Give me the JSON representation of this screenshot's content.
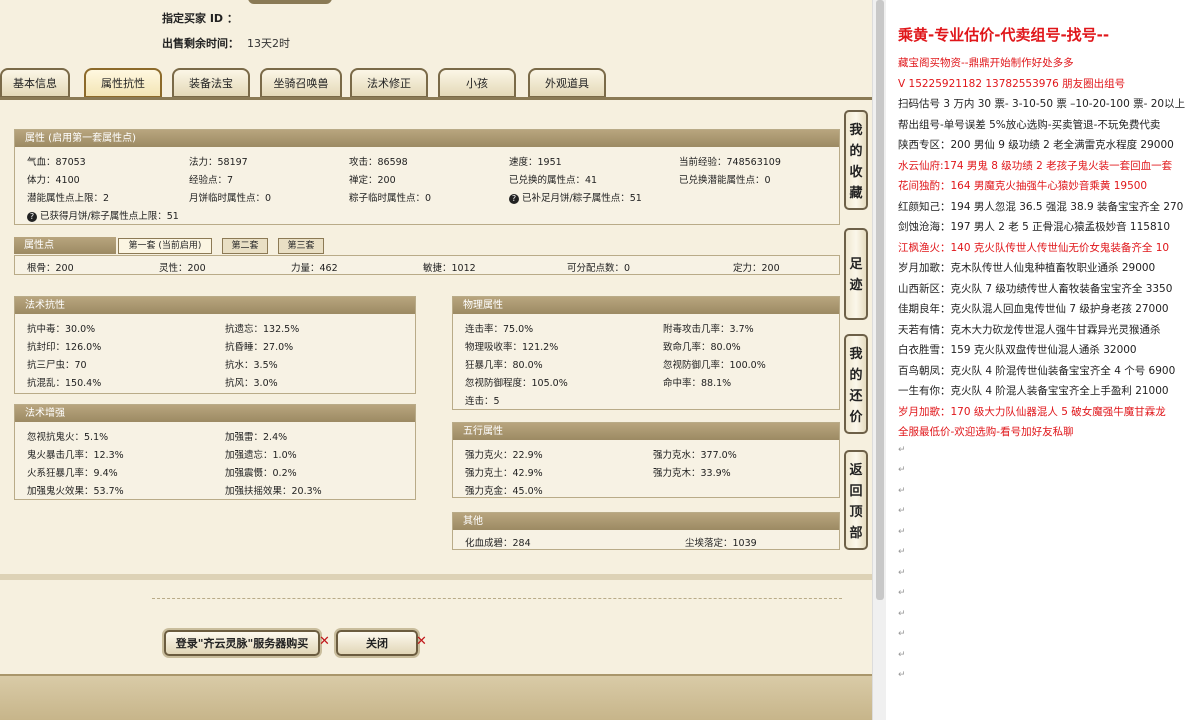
{
  "header": {
    "buyer_id_label": "指定买家 ID ：",
    "time_left_label": "出售剩余时间：",
    "time_left_value": "13天2时"
  },
  "tabs": [
    "基本信息",
    "属性抗性",
    "装备法宝",
    "坐骑召唤兽",
    "法术修正",
    "小孩",
    "外观道具"
  ],
  "attr_panel": {
    "title": "属性 (启用第一套属性点)",
    "rows": [
      [
        "气血：87053",
        "法力：58197",
        "攻击：86598",
        "速度：1951",
        "当前经验：748563109"
      ],
      [
        "体力：4100",
        "经验点：7",
        "禅定：200",
        "已兑换的属性点：41",
        "已兑换潜能属性点：0"
      ],
      [
        "潜能属性点上限：2",
        "月饼临时属性点：0",
        "粽子临时属性点：0",
        "已补足月饼/粽子属性点：51"
      ],
      [
        "已获得月饼/粽子属性点上限：51"
      ]
    ]
  },
  "points_panel": {
    "title": "属性点",
    "subtabs": [
      "第一套 (当前启用)",
      "第二套",
      "第三套"
    ],
    "values": [
      "根骨：200",
      "灵性：200",
      "力量：462",
      "敏捷：1012",
      "可分配点数：0",
      "定力：200"
    ]
  },
  "resist_panel": {
    "title": "法术抗性",
    "items": [
      "抗中毒：30.0%",
      "抗遗忘：132.5%",
      "抗封印：126.0%",
      "抗昏睡：27.0%",
      "抗三尸虫：70",
      "抗水：3.5%",
      "抗混乱：150.4%",
      "抗风：3.0%"
    ]
  },
  "enhance_panel": {
    "title": "法术增强",
    "items": [
      "忽视抗鬼火：5.1%",
      "加强雷：2.4%",
      "鬼火暴击几率：12.3%",
      "加强遗忘：1.0%",
      "火系狂暴几率：9.4%",
      "加强震慑：0.2%",
      "加强鬼火效果：53.7%",
      "加强扶摇效果：20.3%"
    ]
  },
  "physical_panel": {
    "title": "物理属性",
    "items": [
      "连击率：75.0%",
      "附毒攻击几率：3.7%",
      "物理吸收率：121.2%",
      "致命几率：80.0%",
      "狂暴几率：80.0%",
      "忽视防御几率：100.0%",
      "忽视防御程度：105.0%",
      "命中率：88.1%",
      "连击：5"
    ]
  },
  "element_panel": {
    "title": "五行属性",
    "items": [
      "强力克火：22.9%",
      "强力克水：377.0%",
      "强力克土：42.9%",
      "强力克木：33.9%",
      "强力克金：45.0%"
    ]
  },
  "other_panel": {
    "title": "其他",
    "items": [
      "化血成碧：284",
      "尘埃落定：1039"
    ]
  },
  "side_buttons": [
    [
      "我",
      "的",
      "收",
      "藏"
    ],
    [
      "足",
      "迹"
    ],
    [
      "我",
      "的",
      "还",
      "价"
    ],
    [
      "返",
      "回",
      "顶",
      "部"
    ]
  ],
  "bottom": {
    "login_button": "登录\"齐云灵脉\"服务器购买",
    "close_button": "关闭",
    "x": "✕"
  },
  "doc": {
    "lines": [
      {
        "t": "乘黄-专业估价-代卖组号-找号--",
        "c": "#e0161a",
        "big": true
      },
      {
        "t": "藏宝阁买物资--鼎鼎开始制作好处多多",
        "c": "#e0161a"
      },
      {
        "t": "V 15225921182   13782553976 朋友圈出组号",
        "c": "#e0161a"
      },
      {
        "t": "扫码估号 3 万内 30 票- 3-10-50 票  –10-20-100 票- 20以上",
        "c": "#222"
      },
      {
        "t": "帮出组号-单号误差 5%放心选购-买卖管退-不玩免费代卖",
        "c": "#222"
      },
      {
        "t": "陕西专区：200 男仙 9 级功绩 2 老全满雷克水程度 29000",
        "c": "#222"
      },
      {
        "t": "水云仙府:174 男鬼 8 级功绩 2 老孩子鬼火装一套回血一套",
        "c": "#e0161a"
      },
      {
        "t": "花间独酌：164 男魔克火抽强牛心猿妙音乘黄 19500",
        "c": "#e0161a"
      },
      {
        "t": "红颜知己：194 男人忽混 36.5 强混 38.9 装备宝宝齐全 270",
        "c": "#222"
      },
      {
        "t": "剑蚀沧海：197 男人 2 老 5 正骨混心猿孟极妙音 115810",
        "c": "#222"
      },
      {
        "t": "江枫渔火：140 克火队传世人传世仙无价女鬼装备齐全 10",
        "c": "#e0161a"
      },
      {
        "t": "岁月加歌：克木队传世人仙鬼种植畜牧职业通杀 29000",
        "c": "#222"
      },
      {
        "t": "山西新区：克火队 7 级功绩传世人畜牧装备宝宝齐全 3350",
        "c": "#222"
      },
      {
        "t": "佳期良年：克火队混人回血鬼传世仙 7 级护身老孩 27000",
        "c": "#222"
      },
      {
        "t": "天若有情：克木大力砍龙传世混人强牛甘霖异光灵猴通杀",
        "c": "#222"
      },
      {
        "t": "白衣胜雪：159 克火队双盘传世仙混人通杀 32000",
        "c": "#222"
      },
      {
        "t": "百鸟朝凤：克火队 4 阶混传世仙装备宝宝齐全 4 个号 6900",
        "c": "#222"
      },
      {
        "t": "一生有你：克火队 4 阶混人装备宝宝齐全上手盈利 21000",
        "c": "#222"
      },
      {
        "t": "岁月加歌：170 级大力队仙器混人 5 破女魔强牛魔甘霖龙",
        "c": "#e0161a"
      },
      {
        "t": "全服最低价-欢迎选购-看号加好友私聊",
        "c": "#e0161a"
      }
    ]
  }
}
